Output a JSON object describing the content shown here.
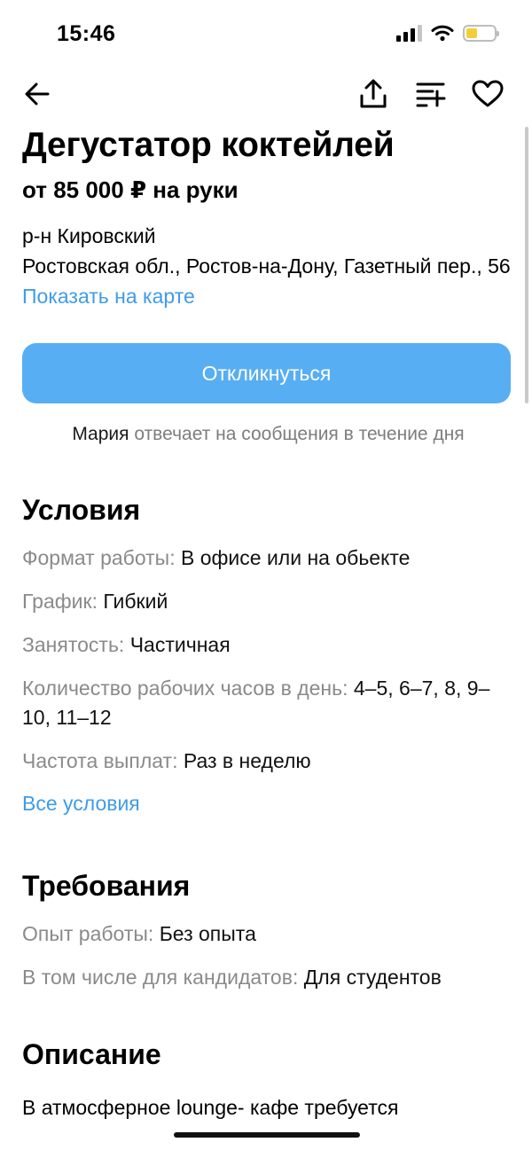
{
  "status_bar": {
    "time": "15:46",
    "icons": [
      "cellular-signal-icon",
      "wifi-icon",
      "battery-icon"
    ]
  },
  "nav": {
    "icons": [
      "back-arrow-icon",
      "share-icon",
      "list-add-icon",
      "heart-icon"
    ]
  },
  "job": {
    "title": "Дегустатор коктейлей",
    "salary": "от 85 000 ₽ на руки",
    "district": "р-н Кировский",
    "address": "Ростовская обл., Ростов-на-Дону, Газетный пер., 56",
    "map_link": "Показать на карте"
  },
  "actions": {
    "respond_label": "Откликнуться",
    "response_name": "Мария",
    "response_text": " отвечает на сообщения в течение дня"
  },
  "conditions": {
    "title": "Условия",
    "rows": [
      {
        "label": "Формат работы:",
        "value": "В офисе или на обьекте"
      },
      {
        "label": "График:",
        "value": "Гибкий"
      },
      {
        "label": "Занятость:",
        "value": "Частичная"
      },
      {
        "label": "Количество рабочих часов в день:",
        "value": "4–5, 6–7, 8, 9–10, 11–12"
      },
      {
        "label": "Частота выплат:",
        "value": "Раз в неделю"
      }
    ],
    "all_link": "Все условия"
  },
  "requirements": {
    "title": "Требования",
    "rows": [
      {
        "label": "Опыт работы:",
        "value": "Без опыта"
      },
      {
        "label": "В том числе для кандидатов:",
        "value": "Для студентов"
      }
    ]
  },
  "description": {
    "title": "Описание",
    "text": "В атмосферное lounge- кафе требуется"
  },
  "colors": {
    "accent": "#58aef2",
    "link": "#3f9ce8",
    "muted": "#8a8a8a",
    "battery_fill": "#f2cf3a"
  }
}
